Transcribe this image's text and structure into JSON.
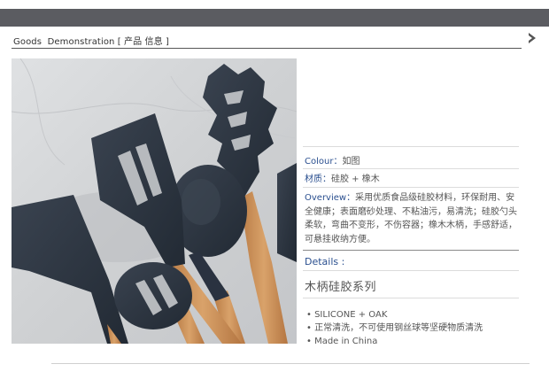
{
  "header": {
    "title": "Goods  Demonstration [ 产品 信息 ]"
  },
  "spec": {
    "colour_label": "Colour：",
    "colour_value": "如图",
    "material_label": "材质：",
    "material_value": "硅胶 + 橡木",
    "overview_label": "Overview：",
    "overview_text": "采用优质食品级硅胶材料，环保耐用、安全健康；表面磨砂处理、不粘油污，易清洗；硅胶勺头柔软，弯曲不变形，不伤容器；橡木木柄，手感舒适，可悬挂收纳方便。",
    "details_label": "Details :",
    "series_name": "木柄硅胶系列",
    "bullets": [
      "SILICONE + OAK",
      "正常清洗，不可使用钢丝球等坚硬物质清洗",
      "Made in China"
    ]
  },
  "colors": {
    "top_bar": "#5b5c61",
    "label_blue": "#2a4f8f",
    "utensil": "#2c3440",
    "wood": "#c98f57",
    "marble": "#d2d4d6"
  }
}
